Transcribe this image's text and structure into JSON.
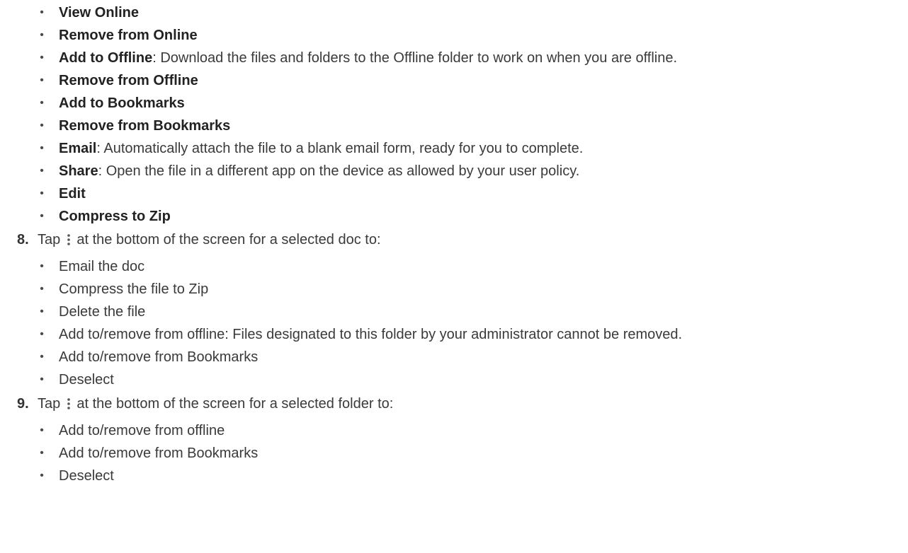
{
  "top_list": [
    {
      "bold": "View Online",
      "rest": ""
    },
    {
      "bold": "Remove from Online",
      "rest": ""
    },
    {
      "bold": "Add to Offline",
      "rest": ": Download the files and folders to the Offline folder to work on when you are offline."
    },
    {
      "bold": "Remove from Offline",
      "rest": ""
    },
    {
      "bold": "Add to Bookmarks",
      "rest": ""
    },
    {
      "bold": "Remove from Bookmarks",
      "rest": ""
    },
    {
      "bold": "Email",
      "rest": ": Automatically attach the file to a blank email form, ready for you to complete."
    },
    {
      "bold": "Share",
      "rest": ": Open the file in a different app on the device as allowed by your user policy."
    },
    {
      "bold": "Edit",
      "rest": ""
    },
    {
      "bold": "Compress to Zip",
      "rest": ""
    }
  ],
  "step8": {
    "number": "8.",
    "before_icon": "Tap",
    "after_icon": "at the bottom of the screen for a selected doc to:",
    "icon": "more-vertical-icon",
    "items": [
      "Email the doc",
      "Compress the file to Zip",
      "Delete the file",
      "Add to/remove from offline:  Files designated to this folder by your administrator cannot be removed.",
      "Add to/remove from Bookmarks",
      "Deselect"
    ]
  },
  "step9": {
    "number": "9.",
    "before_icon": "Tap",
    "after_icon": "at the bottom of the screen for a selected folder to:",
    "icon": "more-vertical-icon",
    "items": [
      "Add to/remove from offline",
      "Add to/remove from Bookmarks",
      "Deselect"
    ]
  },
  "bullet_glyph": "•"
}
